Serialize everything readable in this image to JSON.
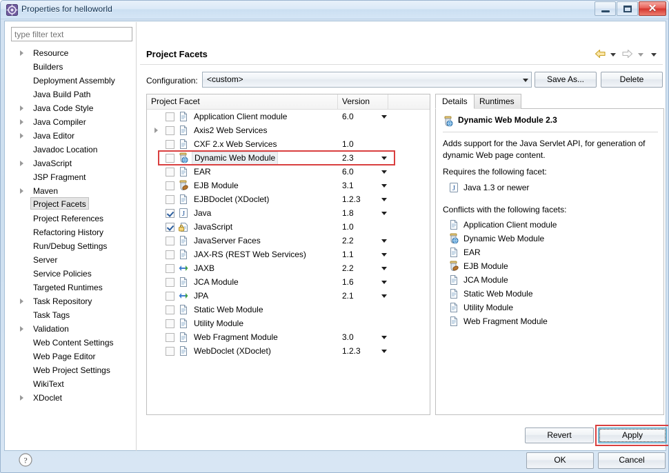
{
  "window": {
    "title": "Properties for helloworld",
    "icon": "eclipse-properties-icon",
    "minimize_label": "Minimize",
    "maximize_label": "Maximize",
    "close_label": "✕"
  },
  "filter": {
    "placeholder": "type filter text",
    "value": ""
  },
  "sidebar": {
    "items": [
      {
        "label": "Resource",
        "expandable": true,
        "selected": false
      },
      {
        "label": "Builders",
        "expandable": false,
        "selected": false
      },
      {
        "label": "Deployment Assembly",
        "expandable": false,
        "selected": false
      },
      {
        "label": "Java Build Path",
        "expandable": false,
        "selected": false
      },
      {
        "label": "Java Code Style",
        "expandable": true,
        "selected": false
      },
      {
        "label": "Java Compiler",
        "expandable": true,
        "selected": false
      },
      {
        "label": "Java Editor",
        "expandable": true,
        "selected": false
      },
      {
        "label": "Javadoc Location",
        "expandable": false,
        "selected": false
      },
      {
        "label": "JavaScript",
        "expandable": true,
        "selected": false
      },
      {
        "label": "JSP Fragment",
        "expandable": false,
        "selected": false
      },
      {
        "label": "Maven",
        "expandable": true,
        "selected": false
      },
      {
        "label": "Project Facets",
        "expandable": false,
        "selected": true
      },
      {
        "label": "Project References",
        "expandable": false,
        "selected": false
      },
      {
        "label": "Refactoring History",
        "expandable": false,
        "selected": false
      },
      {
        "label": "Run/Debug Settings",
        "expandable": false,
        "selected": false
      },
      {
        "label": "Server",
        "expandable": false,
        "selected": false
      },
      {
        "label": "Service Policies",
        "expandable": false,
        "selected": false
      },
      {
        "label": "Targeted Runtimes",
        "expandable": false,
        "selected": false
      },
      {
        "label": "Task Repository",
        "expandable": true,
        "selected": false
      },
      {
        "label": "Task Tags",
        "expandable": false,
        "selected": false
      },
      {
        "label": "Validation",
        "expandable": true,
        "selected": false
      },
      {
        "label": "Web Content Settings",
        "expandable": false,
        "selected": false
      },
      {
        "label": "Web Page Editor",
        "expandable": false,
        "selected": false
      },
      {
        "label": "Web Project Settings",
        "expandable": false,
        "selected": false
      },
      {
        "label": "WikiText",
        "expandable": false,
        "selected": false
      },
      {
        "label": "XDoclet",
        "expandable": true,
        "selected": false
      }
    ]
  },
  "page": {
    "title": "Project Facets",
    "nav_back_icon": "back-arrow-icon",
    "nav_forward_icon": "forward-arrow-icon",
    "nav_menu_icon": "view-menu-icon"
  },
  "configuration": {
    "label": "Configuration:",
    "value": "<custom>",
    "save_as_label": "Save As...",
    "delete_label": "Delete"
  },
  "facet_table": {
    "columns": [
      "Project Facet",
      "Version",
      ""
    ],
    "rows": [
      {
        "name": "Application Client module",
        "version": "6.0",
        "checked": false,
        "expandable": false,
        "has_version_menu": true,
        "icon": "doc-icon",
        "selected": false
      },
      {
        "name": "Axis2 Web Services",
        "version": "",
        "checked": false,
        "expandable": true,
        "has_version_menu": false,
        "icon": "doc-icon",
        "selected": false
      },
      {
        "name": "CXF 2.x Web Services",
        "version": "1.0",
        "checked": false,
        "expandable": false,
        "has_version_menu": false,
        "icon": "doc-icon",
        "selected": false
      },
      {
        "name": "Dynamic Web Module",
        "version": "2.3",
        "checked": false,
        "expandable": false,
        "has_version_menu": true,
        "icon": "webmod-icon",
        "selected": true
      },
      {
        "name": "EAR",
        "version": "6.0",
        "checked": false,
        "expandable": false,
        "has_version_menu": true,
        "icon": "doc-icon",
        "selected": false
      },
      {
        "name": "EJB Module",
        "version": "3.1",
        "checked": false,
        "expandable": false,
        "has_version_menu": true,
        "icon": "ejb-icon",
        "selected": false
      },
      {
        "name": "EJBDoclet (XDoclet)",
        "version": "1.2.3",
        "checked": false,
        "expandable": false,
        "has_version_menu": true,
        "icon": "doc-icon",
        "selected": false
      },
      {
        "name": "Java",
        "version": "1.8",
        "checked": true,
        "expandable": false,
        "has_version_menu": true,
        "icon": "java-icon",
        "selected": false
      },
      {
        "name": "JavaScript",
        "version": "1.0",
        "checked": true,
        "expandable": false,
        "has_version_menu": false,
        "icon": "js-icon",
        "selected": false
      },
      {
        "name": "JavaServer Faces",
        "version": "2.2",
        "checked": false,
        "expandable": false,
        "has_version_menu": true,
        "icon": "doc-icon",
        "selected": false
      },
      {
        "name": "JAX-RS (REST Web Services)",
        "version": "1.1",
        "checked": false,
        "expandable": false,
        "has_version_menu": true,
        "icon": "doc-icon",
        "selected": false
      },
      {
        "name": "JAXB",
        "version": "2.2",
        "checked": false,
        "expandable": false,
        "has_version_menu": true,
        "icon": "jaxb-icon",
        "selected": false
      },
      {
        "name": "JCA Module",
        "version": "1.6",
        "checked": false,
        "expandable": false,
        "has_version_menu": true,
        "icon": "doc-icon",
        "selected": false
      },
      {
        "name": "JPA",
        "version": "2.1",
        "checked": false,
        "expandable": false,
        "has_version_menu": true,
        "icon": "jaxb-icon",
        "selected": false
      },
      {
        "name": "Static Web Module",
        "version": "",
        "checked": false,
        "expandable": false,
        "has_version_menu": false,
        "icon": "doc-icon",
        "selected": false
      },
      {
        "name": "Utility Module",
        "version": "",
        "checked": false,
        "expandable": false,
        "has_version_menu": false,
        "icon": "doc-icon",
        "selected": false
      },
      {
        "name": "Web Fragment Module",
        "version": "3.0",
        "checked": false,
        "expandable": false,
        "has_version_menu": true,
        "icon": "doc-icon",
        "selected": false
      },
      {
        "name": "WebDoclet (XDoclet)",
        "version": "1.2.3",
        "checked": false,
        "expandable": false,
        "has_version_menu": true,
        "icon": "doc-icon",
        "selected": false
      }
    ]
  },
  "details": {
    "tabs": [
      {
        "label": "Details",
        "active": true
      },
      {
        "label": "Runtimes",
        "active": false
      }
    ],
    "heading": "Dynamic Web Module 2.3",
    "heading_icon": "webmod-icon",
    "description": "Adds support for the Java Servlet API, for generation of dynamic Web page content.",
    "requires_label": "Requires the following facet:",
    "requires": [
      {
        "label": "Java 1.3 or newer",
        "icon": "java-icon"
      }
    ],
    "conflicts_label": "Conflicts with the following facets:",
    "conflicts": [
      {
        "label": "Application Client module",
        "icon": "doc-icon"
      },
      {
        "label": "Dynamic Web Module",
        "icon": "webmod-icon"
      },
      {
        "label": "EAR",
        "icon": "doc-icon"
      },
      {
        "label": "EJB Module",
        "icon": "ejb-icon"
      },
      {
        "label": "JCA Module",
        "icon": "doc-icon"
      },
      {
        "label": "Static Web Module",
        "icon": "doc-icon"
      },
      {
        "label": "Utility Module",
        "icon": "doc-icon"
      },
      {
        "label": "Web Fragment Module",
        "icon": "doc-icon"
      }
    ]
  },
  "actions": {
    "revert_label": "Revert",
    "apply_label": "Apply",
    "ok_label": "OK",
    "cancel_label": "Cancel",
    "help_icon": "help-question-icon"
  },
  "annotations": {
    "highlight_color": "#d93f3f",
    "highlighted_row": "Dynamic Web Module",
    "highlighted_button": "Apply"
  }
}
